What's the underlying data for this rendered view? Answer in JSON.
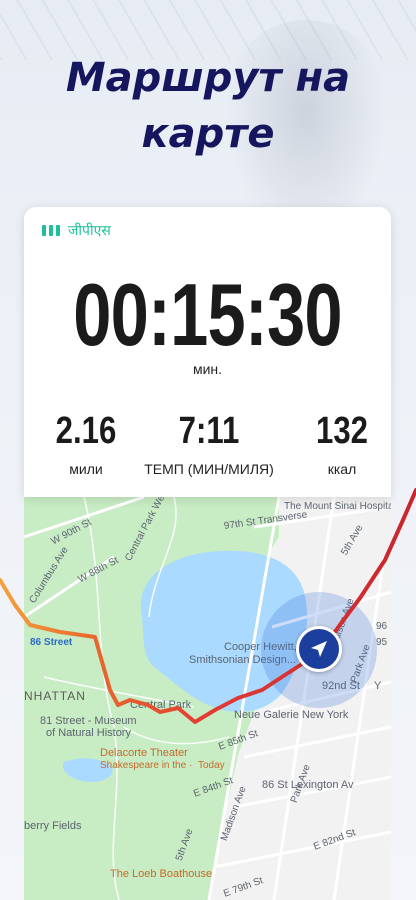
{
  "headline": {
    "line1": "Маршрут на",
    "line2": "карте"
  },
  "tracker": {
    "gps_label": "जीपीएस",
    "timer": "00:15:30",
    "timer_unit": "мин.",
    "stats": [
      {
        "value": "2.16",
        "label": "мили"
      },
      {
        "value": "7:11",
        "label": "ТЕМП (МИН/МИЛЯ)"
      },
      {
        "value": "132",
        "label": "ккал"
      }
    ]
  },
  "map": {
    "labels": {
      "mount_sinai": "The Mount Sinai Hospita",
      "central_park_west": "Central Park West",
      "transverse": "97th St Transverse",
      "w90": "W 90th St",
      "w88": "W 88th St",
      "columbus": "Columbus Ave",
      "fifth": "5th Ave",
      "street_86": "86 Street",
      "madison": "Madison Ave",
      "park": "Park Ave",
      "cooper": "Cooper Hewitt,",
      "smithsonian": "Smithsonian Design...",
      "st92": "92nd St",
      "y_label": "Y",
      "manhattan": "NHATTAN",
      "central_park": "Central Park",
      "st81": "81 Street - Museum",
      "nat_history": "of Natural History",
      "neue": "Neue Galerie New York",
      "e85": "E 85th St",
      "delacorte": "Delacorte Theater",
      "shakespeare": "Shakespeare in the ·",
      "today": "Today",
      "lex86": "86 St Lexington Av",
      "e84": "E 84th St",
      "madison2": "Madison Ave",
      "park2": "Park Ave",
      "fifth2": "5th Ave",
      "e82": "E 82nd St",
      "strawberry": "berry Fields",
      "loeb": "The Loeb Boathouse",
      "e79": "E 79th St",
      "d96": "96",
      "d95": "95"
    },
    "colors": {
      "park": "#c8ecc3",
      "water": "#aadaff",
      "land": "#f2f2f2",
      "route_start": "#f4a23e",
      "route_mid": "#e23b34",
      "route_end": "#c8262e",
      "nav": "#1c3f9e"
    }
  }
}
